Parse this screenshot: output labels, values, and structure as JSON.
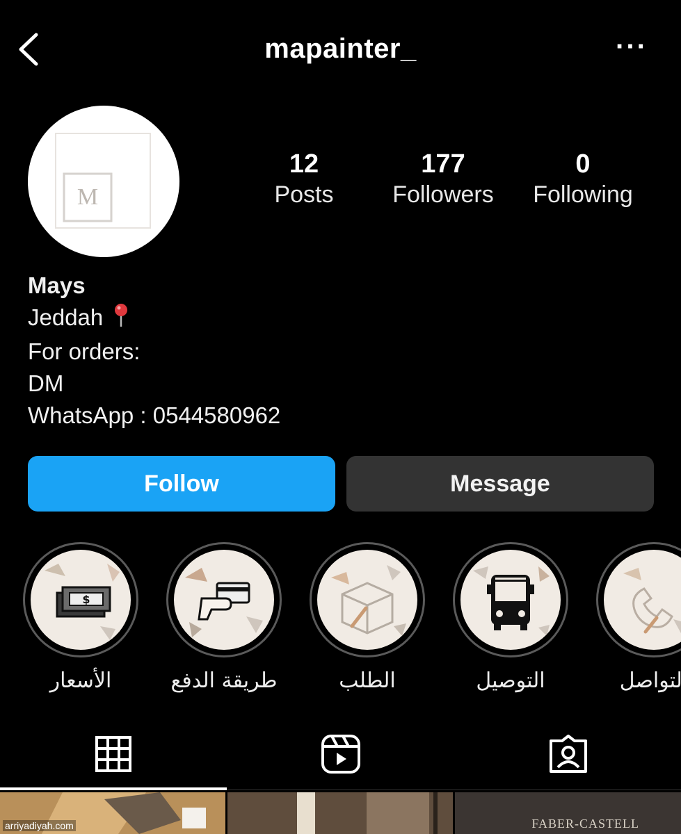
{
  "header": {
    "username": "mapainter_",
    "more_label": "···"
  },
  "profile": {
    "avatar_letter": "M",
    "stats": [
      {
        "value": "12",
        "label": "Posts"
      },
      {
        "value": "177",
        "label": "Followers"
      },
      {
        "value": "0",
        "label": "Following"
      }
    ],
    "bio": {
      "name": "Mays",
      "location": "Jeddah",
      "line3": "For orders:",
      "line4": "DM",
      "line5": "WhatsApp : 0544580962"
    }
  },
  "actions": {
    "follow_label": "Follow",
    "message_label": "Message",
    "follow_color": "#1aa3f5"
  },
  "highlights": [
    {
      "label": "الأسعار",
      "icon": "money-icon"
    },
    {
      "label": "طريقة الدفع",
      "icon": "card-payment-icon"
    },
    {
      "label": "الطلب",
      "icon": "box-icon"
    },
    {
      "label": "التوصيل",
      "icon": "bus-icon"
    },
    {
      "label": "التواصل",
      "icon": "phone-contact-icon"
    }
  ],
  "tabs": [
    {
      "icon": "grid-icon",
      "active": true
    },
    {
      "icon": "reels-icon",
      "active": false
    },
    {
      "icon": "tagged-icon",
      "active": false
    }
  ],
  "footer": {
    "watermark": "arriyadiyah.com",
    "thumb3_brand": "FABER-CASTELL"
  }
}
